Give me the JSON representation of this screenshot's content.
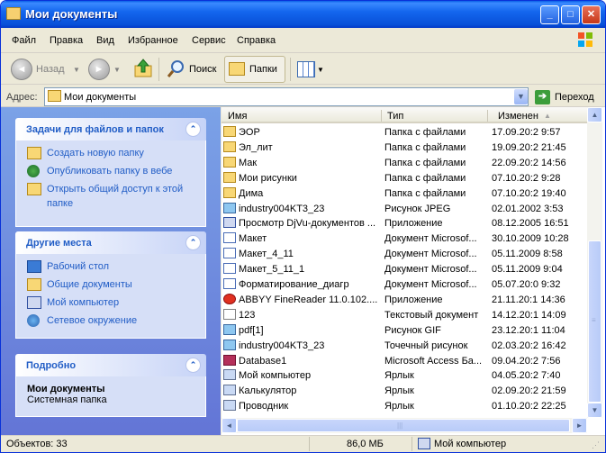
{
  "window": {
    "title": "Мои документы"
  },
  "menu": [
    "Файл",
    "Правка",
    "Вид",
    "Избранное",
    "Сервис",
    "Справка"
  ],
  "toolbar": {
    "back": "Назад",
    "search": "Поиск",
    "folders": "Папки"
  },
  "address": {
    "label": "Адрес:",
    "value": "Мои документы",
    "go": "Переход"
  },
  "tasks": {
    "title": "Задачи для файлов и папок",
    "items": [
      "Создать новую папку",
      "Опубликовать папку в вебе",
      "Открыть общий доступ к этой папке"
    ]
  },
  "places": {
    "title": "Другие места",
    "items": [
      "Рабочий стол",
      "Общие документы",
      "Мой компьютер",
      "Сетевое окружение"
    ]
  },
  "details": {
    "title": "Подробно",
    "name": "Мои документы",
    "type": "Системная папка"
  },
  "columns": {
    "name": "Имя",
    "type": "Тип",
    "modified": "Изменен"
  },
  "files": [
    {
      "name": "ЭОР",
      "type": "Папка с файлами",
      "modified": "17.09.20:2 9:57",
      "icon": "folder"
    },
    {
      "name": "Эл_лит",
      "type": "Папка с файлами",
      "modified": "19.09.20:2 21:45",
      "icon": "folder"
    },
    {
      "name": "Мак",
      "type": "Папка с файлами",
      "modified": "22.09.20:2 14:56",
      "icon": "folder"
    },
    {
      "name": "Мои рисунки",
      "type": "Папка с файлами",
      "modified": "07.10.20:2 9:28",
      "icon": "folder"
    },
    {
      "name": "Дима",
      "type": "Папка с файлами",
      "modified": "07.10.20:2 19:40",
      "icon": "folder"
    },
    {
      "name": "industry004KT3_23",
      "type": "Рисунок JPEG",
      "modified": "02.01.2002 3:53",
      "icon": "img"
    },
    {
      "name": "Просмотр DjVu-документов ...",
      "type": "Приложение",
      "modified": "08.12.2005 16:51",
      "icon": "app"
    },
    {
      "name": "Макет",
      "type": "Документ Microsof...",
      "modified": "30.10.2009 10:28",
      "icon": "doc"
    },
    {
      "name": "Макет_4_11",
      "type": "Документ Microsof...",
      "modified": "05.11.2009 8:58",
      "icon": "doc"
    },
    {
      "name": "Макет_5_11_1",
      "type": "Документ Microsof...",
      "modified": "05.11.2009 9:04",
      "icon": "doc"
    },
    {
      "name": "Форматирование_диагр",
      "type": "Документ Microsof...",
      "modified": "05.07.20:0 9:32",
      "icon": "doc"
    },
    {
      "name": "ABBYY FineReader 11.0.102....",
      "type": "Приложение",
      "modified": "21.11.20:1 14:36",
      "icon": "red"
    },
    {
      "name": "123",
      "type": "Текстовый документ",
      "modified": "14.12.20:1 14:09",
      "icon": "txt"
    },
    {
      "name": "pdf[1]",
      "type": "Рисунок GIF",
      "modified": "23.12.20:1 11:04",
      "icon": "img"
    },
    {
      "name": "industry004KT3_23",
      "type": "Точечный рисунок",
      "modified": "02.03.20:2 16:42",
      "icon": "img"
    },
    {
      "name": "Database1",
      "type": "Microsoft Access Ба...",
      "modified": "09.04.20:2 7:56",
      "icon": "acc"
    },
    {
      "name": "Мой компьютер",
      "type": "Ярлык",
      "modified": "04.05.20:2 7:40",
      "icon": "lnk"
    },
    {
      "name": "Калькулятор",
      "type": "Ярлык",
      "modified": "02.09.20:2 21:59",
      "icon": "lnk"
    },
    {
      "name": "Проводник",
      "type": "Ярлык",
      "modified": "01.10.20:2 22:25",
      "icon": "lnk"
    }
  ],
  "status": {
    "objects": "Объектов: 33",
    "size": "86,0 МБ",
    "location": "Мой компьютер"
  }
}
